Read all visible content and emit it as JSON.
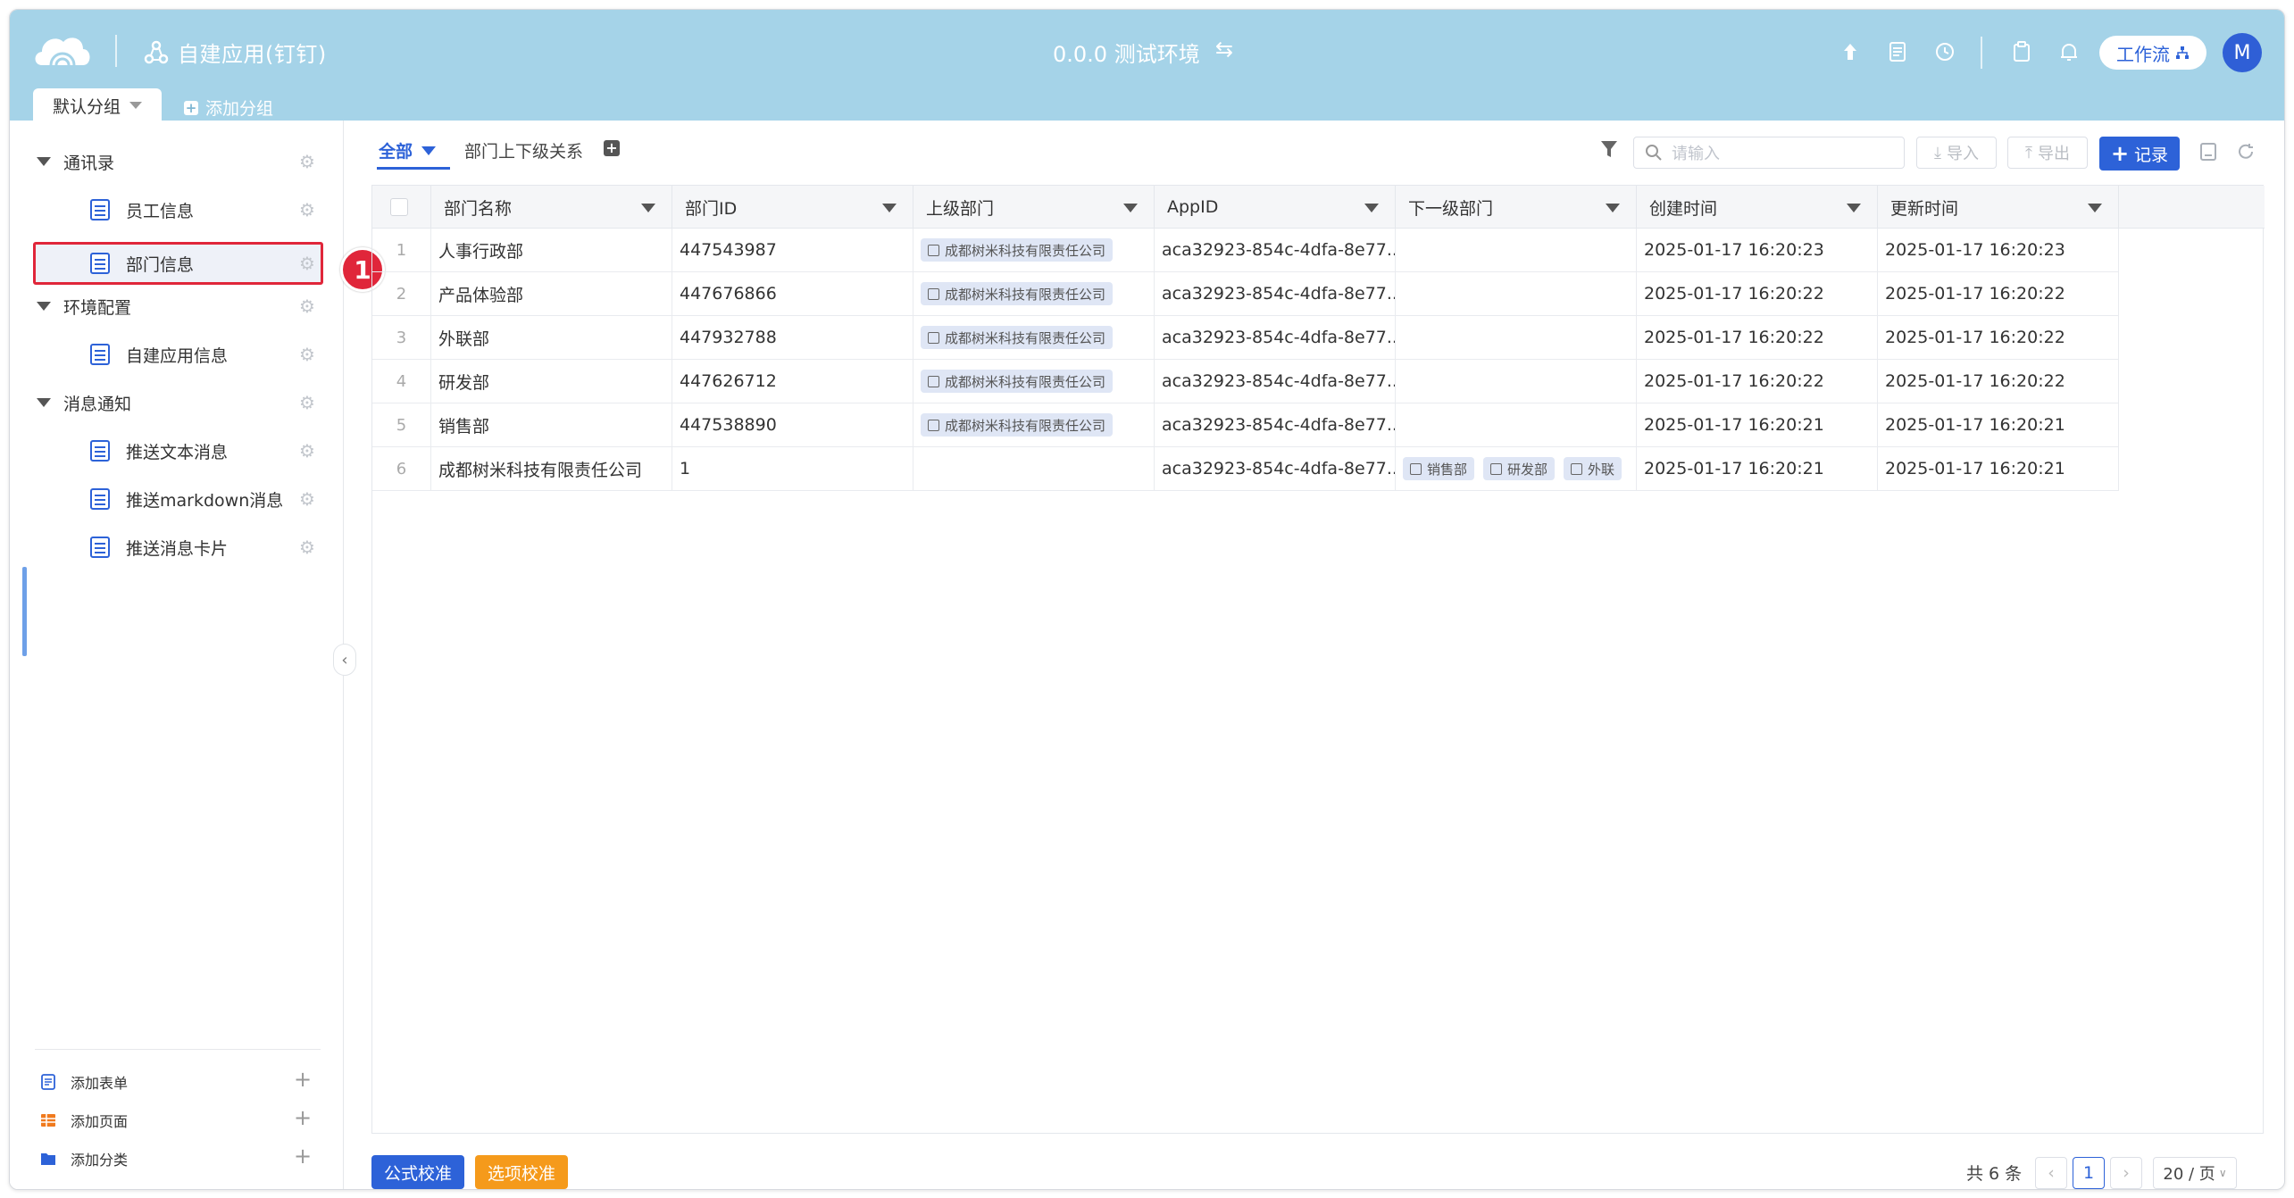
{
  "header": {
    "app_title": "自建应用(钉钉)",
    "env_label": "0.0.0 测试环境",
    "workflow_label": "工作流",
    "avatar_initial": "M",
    "group_tab": "默认分组",
    "add_group": "添加分组"
  },
  "sidebar": {
    "groups": [
      {
        "label": "通讯录",
        "items": [
          {
            "label": "员工信息"
          },
          {
            "label": "部门信息"
          }
        ]
      },
      {
        "label": "环境配置",
        "items": [
          {
            "label": "自建应用信息"
          }
        ]
      },
      {
        "label": "消息通知",
        "items": [
          {
            "label": "推送文本消息"
          },
          {
            "label": "推送markdown消息"
          },
          {
            "label": "推送消息卡片"
          }
        ]
      }
    ],
    "annotation_badge": "1",
    "footer": [
      {
        "label": "添加表单",
        "icon": "form-icon"
      },
      {
        "label": "添加页面",
        "icon": "page-icon"
      },
      {
        "label": "添加分类",
        "icon": "folder-icon"
      }
    ]
  },
  "toolbar": {
    "tab_all": "全部",
    "tab_relation": "部门上下级关系",
    "search_placeholder": "请输入",
    "import_label": "导入",
    "export_label": "导出",
    "record_label": "记录"
  },
  "table": {
    "columns": [
      "部门名称",
      "部门ID",
      "上级部门",
      "AppID",
      "下一级部门",
      "创建时间",
      "更新时间"
    ],
    "rows": [
      {
        "num": "1",
        "name": "人事行政部",
        "id": "447543987",
        "parent": "成都树米科技有限责任公司",
        "appid": "aca32923-854c-4dfa-8e77...",
        "children": [],
        "created": "2025-01-17 16:20:23",
        "updated": "2025-01-17 16:20:23"
      },
      {
        "num": "2",
        "name": "产品体验部",
        "id": "447676866",
        "parent": "成都树米科技有限责任公司",
        "appid": "aca32923-854c-4dfa-8e77...",
        "children": [],
        "created": "2025-01-17 16:20:22",
        "updated": "2025-01-17 16:20:22"
      },
      {
        "num": "3",
        "name": "外联部",
        "id": "447932788",
        "parent": "成都树米科技有限责任公司",
        "appid": "aca32923-854c-4dfa-8e77...",
        "children": [],
        "created": "2025-01-17 16:20:22",
        "updated": "2025-01-17 16:20:22"
      },
      {
        "num": "4",
        "name": "研发部",
        "id": "447626712",
        "parent": "成都树米科技有限责任公司",
        "appid": "aca32923-854c-4dfa-8e77...",
        "children": [],
        "created": "2025-01-17 16:20:22",
        "updated": "2025-01-17 16:20:22"
      },
      {
        "num": "5",
        "name": "销售部",
        "id": "447538890",
        "parent": "成都树米科技有限责任公司",
        "appid": "aca32923-854c-4dfa-8e77...",
        "children": [],
        "created": "2025-01-17 16:20:21",
        "updated": "2025-01-17 16:20:21"
      },
      {
        "num": "6",
        "name": "成都树米科技有限责任公司",
        "id": "1",
        "parent": "",
        "appid": "aca32923-854c-4dfa-8e77...",
        "children": [
          "销售部",
          "研发部",
          "外联"
        ],
        "created": "2025-01-17 16:20:21",
        "updated": "2025-01-17 16:20:21"
      }
    ]
  },
  "footer": {
    "formula_btn": "公式校准",
    "option_btn": "选项校准",
    "total": "共 6 条",
    "current_page": "1",
    "page_size": "20 / 页"
  },
  "colors": {
    "header_bg": "#a5d3e8",
    "primary": "#2d62d8",
    "warning": "#f59a1b",
    "annotation": "#e0263a"
  }
}
